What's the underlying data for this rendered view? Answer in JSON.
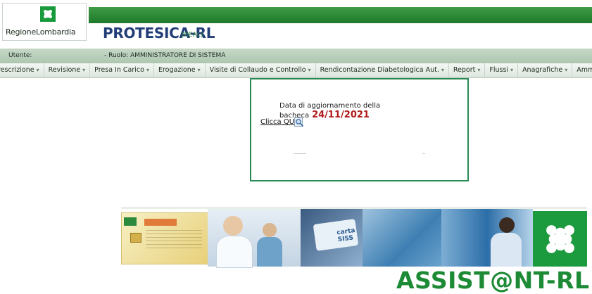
{
  "header": {
    "logo_text": "RegioneLombardia",
    "app_title": "PROTESICA-RL",
    "env_tag": "[REAL]"
  },
  "userbar": {
    "user_label": "Utente:",
    "role_label": "- Ruolo: AMMINISTRATORE DI SISTEMA"
  },
  "menu": {
    "items": [
      {
        "label": "rescrizione"
      },
      {
        "label": "Revisione"
      },
      {
        "label": "Presa In Carico"
      },
      {
        "label": "Erogazione"
      },
      {
        "label": "Visite di Collaudo e Controllo"
      },
      {
        "label": "Rendicontazione Diabetologica Aut."
      },
      {
        "label": "Report"
      },
      {
        "label": "Flussi"
      },
      {
        "label": "Anagrafiche"
      },
      {
        "label": "Amministrazione"
      }
    ]
  },
  "notice": {
    "text": "Data di aggiornamento della bacheca",
    "date": "24/11/2021",
    "link": "Clicca QUI"
  },
  "banner": {
    "card_brand": "carta SISS",
    "title": "ASSIST@NT-RL"
  },
  "colors": {
    "brand_green": "#1c9a3e",
    "title_blue": "#223d78",
    "date_red": "#b01818"
  }
}
